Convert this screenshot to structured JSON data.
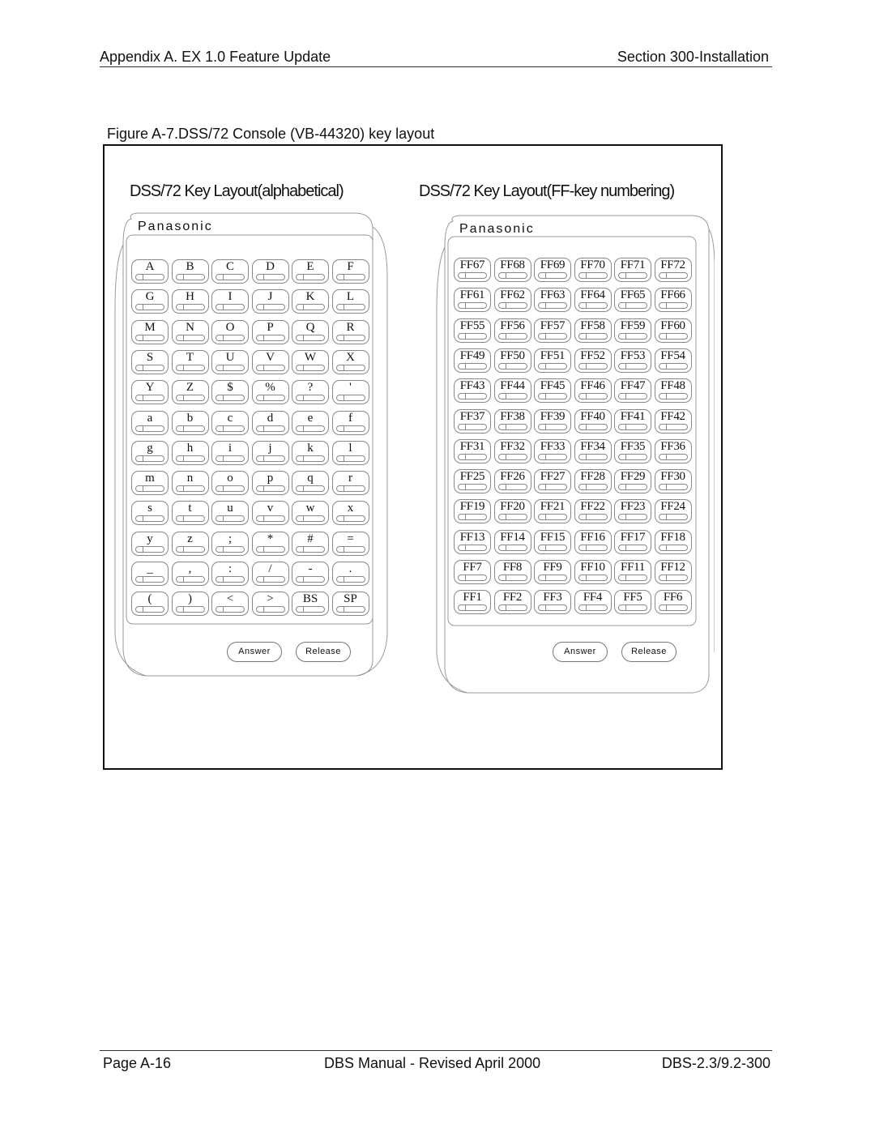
{
  "header": {
    "left": "Appendix A. EX 1.0 Feature Update",
    "right": "Section 300-Installation"
  },
  "figure": {
    "caption": "Figure A-7.DSS/72 Console (VB-44320) key layout",
    "panels": [
      {
        "title": "DSS/72 Key Layout(alphabetical)",
        "brand": "Panasonic",
        "keys": [
          [
            "A",
            "B",
            "C",
            "D",
            "E",
            "F"
          ],
          [
            "G",
            "H",
            "I",
            "J",
            "K",
            "L"
          ],
          [
            "M",
            "N",
            "O",
            "P",
            "Q",
            "R"
          ],
          [
            "S",
            "T",
            "U",
            "V",
            "W",
            "X"
          ],
          [
            "Y",
            "Z",
            "$",
            "%",
            "?",
            "'"
          ],
          [
            "a",
            "b",
            "c",
            "d",
            "e",
            "f"
          ],
          [
            "g",
            "h",
            "i",
            "j",
            "k",
            "l"
          ],
          [
            "m",
            "n",
            "o",
            "p",
            "q",
            "r"
          ],
          [
            "s",
            "t",
            "u",
            "v",
            "w",
            "x"
          ],
          [
            "y",
            "z",
            ";",
            "*",
            "#",
            "="
          ],
          [
            "_",
            ",",
            ":",
            "/",
            "-",
            "."
          ],
          [
            "(",
            ")",
            "<",
            ">",
            "BS",
            "SP"
          ]
        ],
        "buttons": [
          "Answer",
          "Release"
        ]
      },
      {
        "title": "DSS/72 Key Layout(FF-key numbering)",
        "brand": "Panasonic",
        "keys": [
          [
            "FF67",
            "FF68",
            "FF69",
            "FF70",
            "FF71",
            "FF72"
          ],
          [
            "FF61",
            "FF62",
            "FF63",
            "FF64",
            "FF65",
            "FF66"
          ],
          [
            "FF55",
            "FF56",
            "FF57",
            "FF58",
            "FF59",
            "FF60"
          ],
          [
            "FF49",
            "FF50",
            "FF51",
            "FF52",
            "FF53",
            "FF54"
          ],
          [
            "FF43",
            "FF44",
            "FF45",
            "FF46",
            "FF47",
            "FF48"
          ],
          [
            "FF37",
            "FF38",
            "FF39",
            "FF40",
            "FF41",
            "FF42"
          ],
          [
            "FF31",
            "FF32",
            "FF33",
            "FF34",
            "FF35",
            "FF36"
          ],
          [
            "FF25",
            "FF26",
            "FF27",
            "FF28",
            "FF29",
            "FF30"
          ],
          [
            "FF19",
            "FF20",
            "FF21",
            "FF22",
            "FF23",
            "FF24"
          ],
          [
            "FF13",
            "FF14",
            "FF15",
            "FF16",
            "FF17",
            "FF18"
          ],
          [
            "FF7",
            "FF8",
            "FF9",
            "FF10",
            "FF11",
            "FF12"
          ],
          [
            "FF1",
            "FF2",
            "FF3",
            "FF4",
            "FF5",
            "FF6"
          ]
        ],
        "buttons": [
          "Answer",
          "Release"
        ]
      }
    ]
  },
  "footer": {
    "left": "Page A-16",
    "center": "DBS Manual - Revised April 2000",
    "right": "DBS-2.3/9.2-300"
  }
}
